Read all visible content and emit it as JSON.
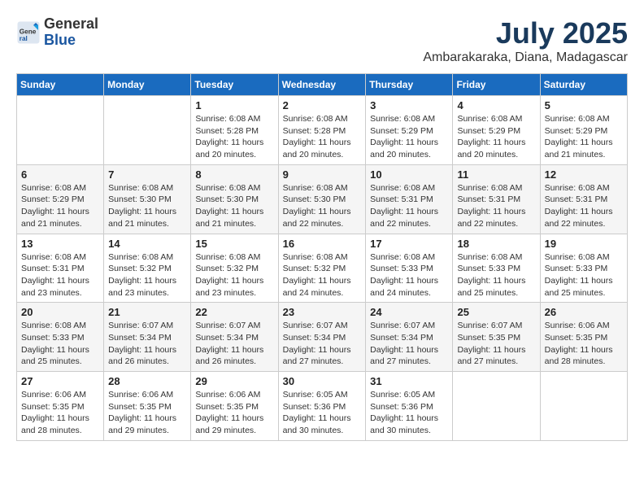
{
  "header": {
    "logo_general": "General",
    "logo_blue": "Blue",
    "title": "July 2025",
    "location": "Ambarakaraka, Diana, Madagascar"
  },
  "weekdays": [
    "Sunday",
    "Monday",
    "Tuesday",
    "Wednesday",
    "Thursday",
    "Friday",
    "Saturday"
  ],
  "weeks": [
    [
      {
        "day": "",
        "info": ""
      },
      {
        "day": "",
        "info": ""
      },
      {
        "day": "1",
        "info": "Sunrise: 6:08 AM\nSunset: 5:28 PM\nDaylight: 11 hours and 20 minutes."
      },
      {
        "day": "2",
        "info": "Sunrise: 6:08 AM\nSunset: 5:28 PM\nDaylight: 11 hours and 20 minutes."
      },
      {
        "day": "3",
        "info": "Sunrise: 6:08 AM\nSunset: 5:29 PM\nDaylight: 11 hours and 20 minutes."
      },
      {
        "day": "4",
        "info": "Sunrise: 6:08 AM\nSunset: 5:29 PM\nDaylight: 11 hours and 20 minutes."
      },
      {
        "day": "5",
        "info": "Sunrise: 6:08 AM\nSunset: 5:29 PM\nDaylight: 11 hours and 21 minutes."
      }
    ],
    [
      {
        "day": "6",
        "info": "Sunrise: 6:08 AM\nSunset: 5:29 PM\nDaylight: 11 hours and 21 minutes."
      },
      {
        "day": "7",
        "info": "Sunrise: 6:08 AM\nSunset: 5:30 PM\nDaylight: 11 hours and 21 minutes."
      },
      {
        "day": "8",
        "info": "Sunrise: 6:08 AM\nSunset: 5:30 PM\nDaylight: 11 hours and 21 minutes."
      },
      {
        "day": "9",
        "info": "Sunrise: 6:08 AM\nSunset: 5:30 PM\nDaylight: 11 hours and 22 minutes."
      },
      {
        "day": "10",
        "info": "Sunrise: 6:08 AM\nSunset: 5:31 PM\nDaylight: 11 hours and 22 minutes."
      },
      {
        "day": "11",
        "info": "Sunrise: 6:08 AM\nSunset: 5:31 PM\nDaylight: 11 hours and 22 minutes."
      },
      {
        "day": "12",
        "info": "Sunrise: 6:08 AM\nSunset: 5:31 PM\nDaylight: 11 hours and 22 minutes."
      }
    ],
    [
      {
        "day": "13",
        "info": "Sunrise: 6:08 AM\nSunset: 5:31 PM\nDaylight: 11 hours and 23 minutes."
      },
      {
        "day": "14",
        "info": "Sunrise: 6:08 AM\nSunset: 5:32 PM\nDaylight: 11 hours and 23 minutes."
      },
      {
        "day": "15",
        "info": "Sunrise: 6:08 AM\nSunset: 5:32 PM\nDaylight: 11 hours and 23 minutes."
      },
      {
        "day": "16",
        "info": "Sunrise: 6:08 AM\nSunset: 5:32 PM\nDaylight: 11 hours and 24 minutes."
      },
      {
        "day": "17",
        "info": "Sunrise: 6:08 AM\nSunset: 5:33 PM\nDaylight: 11 hours and 24 minutes."
      },
      {
        "day": "18",
        "info": "Sunrise: 6:08 AM\nSunset: 5:33 PM\nDaylight: 11 hours and 25 minutes."
      },
      {
        "day": "19",
        "info": "Sunrise: 6:08 AM\nSunset: 5:33 PM\nDaylight: 11 hours and 25 minutes."
      }
    ],
    [
      {
        "day": "20",
        "info": "Sunrise: 6:08 AM\nSunset: 5:33 PM\nDaylight: 11 hours and 25 minutes."
      },
      {
        "day": "21",
        "info": "Sunrise: 6:07 AM\nSunset: 5:34 PM\nDaylight: 11 hours and 26 minutes."
      },
      {
        "day": "22",
        "info": "Sunrise: 6:07 AM\nSunset: 5:34 PM\nDaylight: 11 hours and 26 minutes."
      },
      {
        "day": "23",
        "info": "Sunrise: 6:07 AM\nSunset: 5:34 PM\nDaylight: 11 hours and 27 minutes."
      },
      {
        "day": "24",
        "info": "Sunrise: 6:07 AM\nSunset: 5:34 PM\nDaylight: 11 hours and 27 minutes."
      },
      {
        "day": "25",
        "info": "Sunrise: 6:07 AM\nSunset: 5:35 PM\nDaylight: 11 hours and 27 minutes."
      },
      {
        "day": "26",
        "info": "Sunrise: 6:06 AM\nSunset: 5:35 PM\nDaylight: 11 hours and 28 minutes."
      }
    ],
    [
      {
        "day": "27",
        "info": "Sunrise: 6:06 AM\nSunset: 5:35 PM\nDaylight: 11 hours and 28 minutes."
      },
      {
        "day": "28",
        "info": "Sunrise: 6:06 AM\nSunset: 5:35 PM\nDaylight: 11 hours and 29 minutes."
      },
      {
        "day": "29",
        "info": "Sunrise: 6:06 AM\nSunset: 5:35 PM\nDaylight: 11 hours and 29 minutes."
      },
      {
        "day": "30",
        "info": "Sunrise: 6:05 AM\nSunset: 5:36 PM\nDaylight: 11 hours and 30 minutes."
      },
      {
        "day": "31",
        "info": "Sunrise: 6:05 AM\nSunset: 5:36 PM\nDaylight: 11 hours and 30 minutes."
      },
      {
        "day": "",
        "info": ""
      },
      {
        "day": "",
        "info": ""
      }
    ]
  ]
}
